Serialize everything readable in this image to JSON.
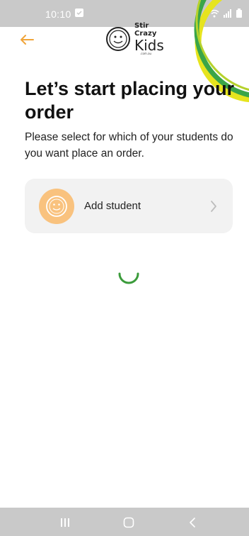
{
  "status_bar": {
    "time": "10:10"
  },
  "header": {
    "back_icon": "arrow-left-icon"
  },
  "logo": {
    "line1": "Stir",
    "line2": "Crazy",
    "line3": "Kids",
    "domain": ".com.au"
  },
  "main": {
    "title": "Let’s start placing your order",
    "subtitle": "Please select for which of your students do you want place an order.",
    "add_student_label": "Add student"
  },
  "colors": {
    "accent_orange": "#f0a53a",
    "avatar_bg": "#f9c27e",
    "spinner_green": "#3b9b3b",
    "deco_yellow": "#e6e41e",
    "deco_green": "#3aa548",
    "card_bg": "#f2f2f2"
  },
  "nav": {
    "recents_icon": "recents-icon",
    "home_icon": "home-icon",
    "back_icon": "back-icon"
  }
}
